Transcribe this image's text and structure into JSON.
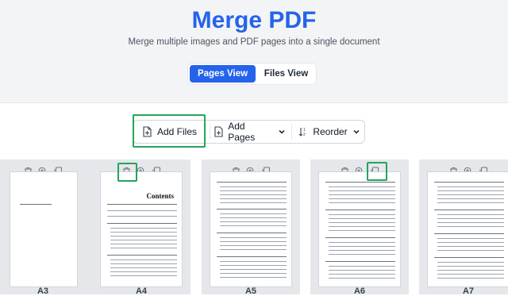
{
  "header": {
    "title": "Merge PDF",
    "subtitle": "Merge multiple images and PDF pages into a single document"
  },
  "view_toggle": {
    "pages_label": "Pages View",
    "files_label": "Files View",
    "active": "Pages View"
  },
  "toolbar": {
    "add_files_label": "Add Files",
    "add_pages_label": "Add Pages",
    "reorder_label": "Reorder"
  },
  "colors": {
    "accent": "#2563eb",
    "highlight": "#22a55a"
  },
  "pages": [
    {
      "label": "A3",
      "heading": "",
      "icons": [
        "trash-icon",
        "zoom-in-icon",
        "duplicate-icon"
      ]
    },
    {
      "label": "A4",
      "heading": "Contents",
      "icons": [
        "trash-icon",
        "zoom-in-icon",
        "duplicate-icon"
      ]
    },
    {
      "label": "A5",
      "heading": "",
      "icons": [
        "trash-icon",
        "zoom-in-icon",
        "duplicate-icon"
      ]
    },
    {
      "label": "A6",
      "heading": "",
      "icons": [
        "trash-icon",
        "zoom-in-icon",
        "duplicate-icon"
      ]
    },
    {
      "label": "A7",
      "heading": "",
      "icons": [
        "trash-icon",
        "zoom-in-icon",
        "duplicate-icon"
      ]
    }
  ]
}
